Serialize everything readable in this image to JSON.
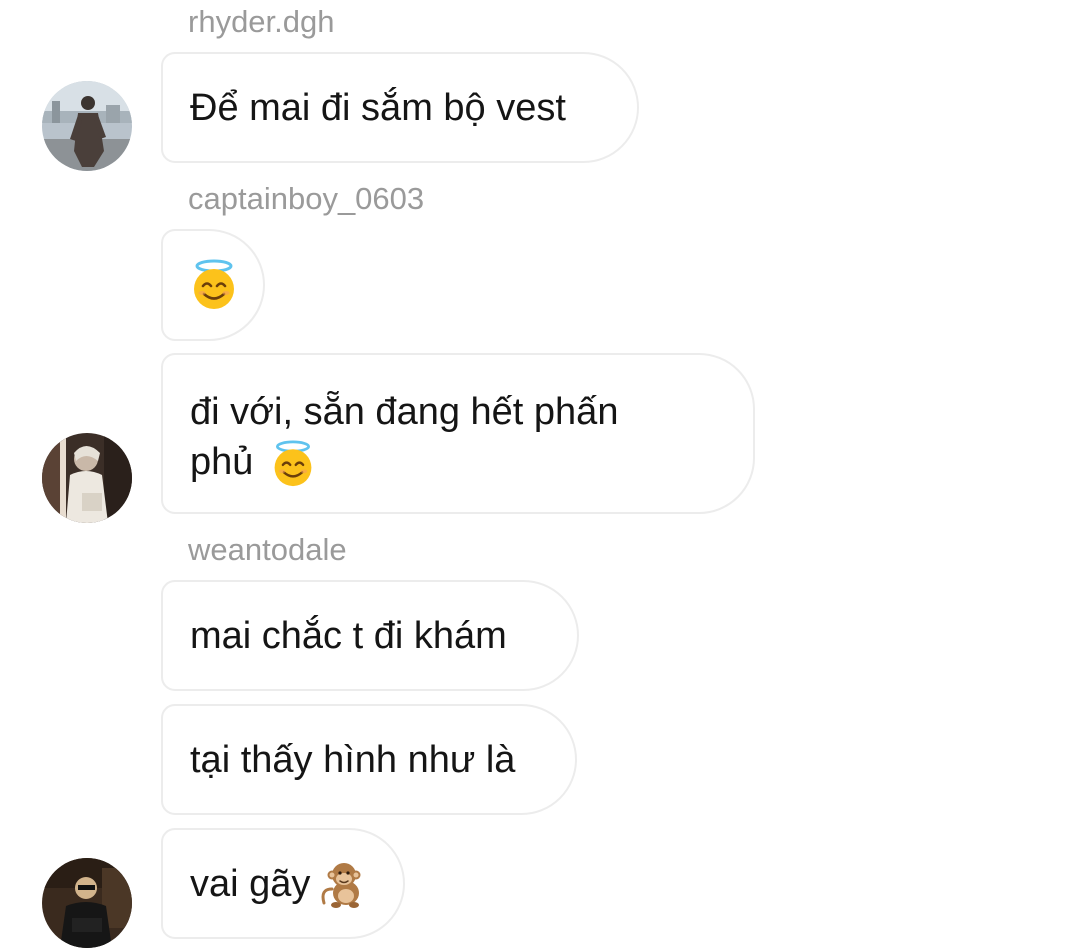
{
  "messages": [
    {
      "username": "rhyder.dgh",
      "text": "Để mai đi sắm bộ vest"
    },
    {
      "username": "captainboy_0603",
      "emoji_icon": "smiling-face-with-halo-icon"
    },
    {
      "text_line1": "đi với, sẵn đang hết phấn",
      "text_line2": "phủ",
      "emoji_icon": "smiling-face-with-halo-icon"
    },
    {
      "username": "weantodale",
      "text": "mai chắc t đi khám"
    },
    {
      "text": "tại thấy hình như là"
    },
    {
      "text": "vai gãy",
      "emoji_icon": "monkey-icon"
    }
  ],
  "colors": {
    "username": "#9a9a9a",
    "bubble_border": "#ececec",
    "text": "#151515",
    "background": "#ffffff"
  }
}
